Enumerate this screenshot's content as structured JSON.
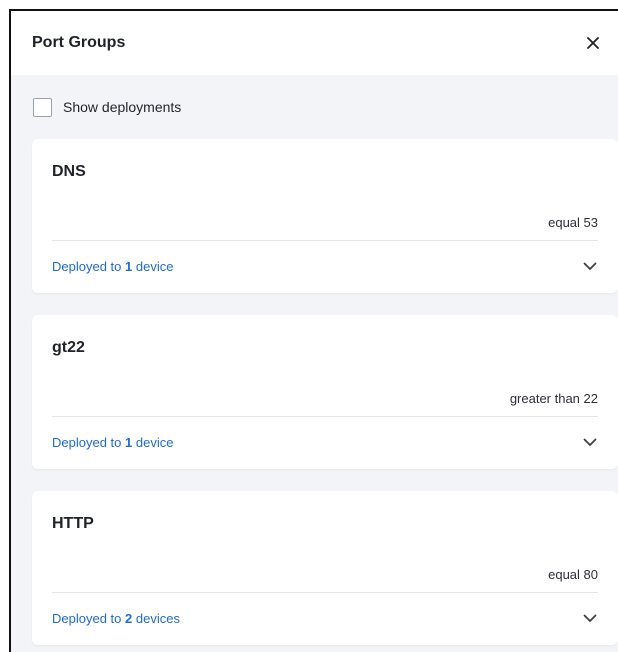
{
  "panel": {
    "title": "Port Groups",
    "close_icon": "close-icon"
  },
  "toggle": {
    "label": "Show deployments",
    "checked": false
  },
  "port_groups": [
    {
      "name": "DNS",
      "value": "equal 53",
      "deploy_prefix": "Deployed to",
      "deploy_count": "1",
      "deploy_suffix": "device"
    },
    {
      "name": "gt22",
      "value": "greater than 22",
      "deploy_prefix": "Deployed to",
      "deploy_count": "1",
      "deploy_suffix": "device"
    },
    {
      "name": "HTTP",
      "value": "equal 80",
      "deploy_prefix": "Deployed to",
      "deploy_count": "2",
      "deploy_suffix": "devices"
    }
  ],
  "colors": {
    "link": "#1c6bd6",
    "panel_bg": "#f3f4f7",
    "card_bg": "#ffffff"
  }
}
